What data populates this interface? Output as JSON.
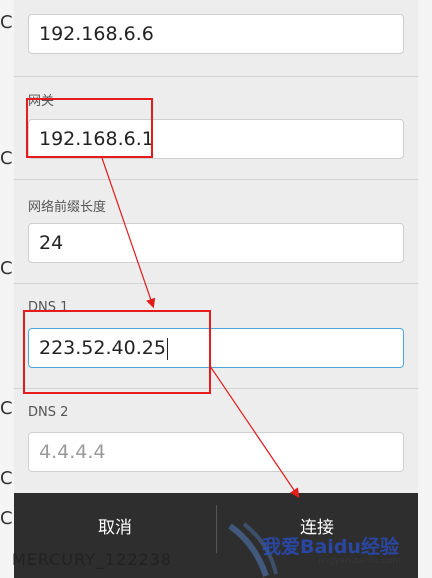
{
  "background": {
    "left_fragments": [
      "C",
      "C",
      "C",
      "C",
      "C",
      "C"
    ],
    "bottom_text": "MERCURY_122238"
  },
  "dialog": {
    "ip_field": {
      "value": "192.168.6.6"
    },
    "gateway": {
      "label": "网关",
      "value": "192.168.6.1"
    },
    "prefix": {
      "label": "网络前缀长度",
      "value": "24"
    },
    "dns1": {
      "label": "DNS 1",
      "value": "223.52.40.25"
    },
    "dns2": {
      "label": "DNS 2",
      "placeholder": "4.4.4.4"
    }
  },
  "buttons": {
    "cancel": "取消",
    "connect": "连接"
  },
  "watermark": {
    "text": "我爱Baidu经验",
    "url": "jingyan.baidu.com"
  },
  "colors": {
    "annotation": "#e51c1c",
    "focus": "#4aa9d8"
  }
}
